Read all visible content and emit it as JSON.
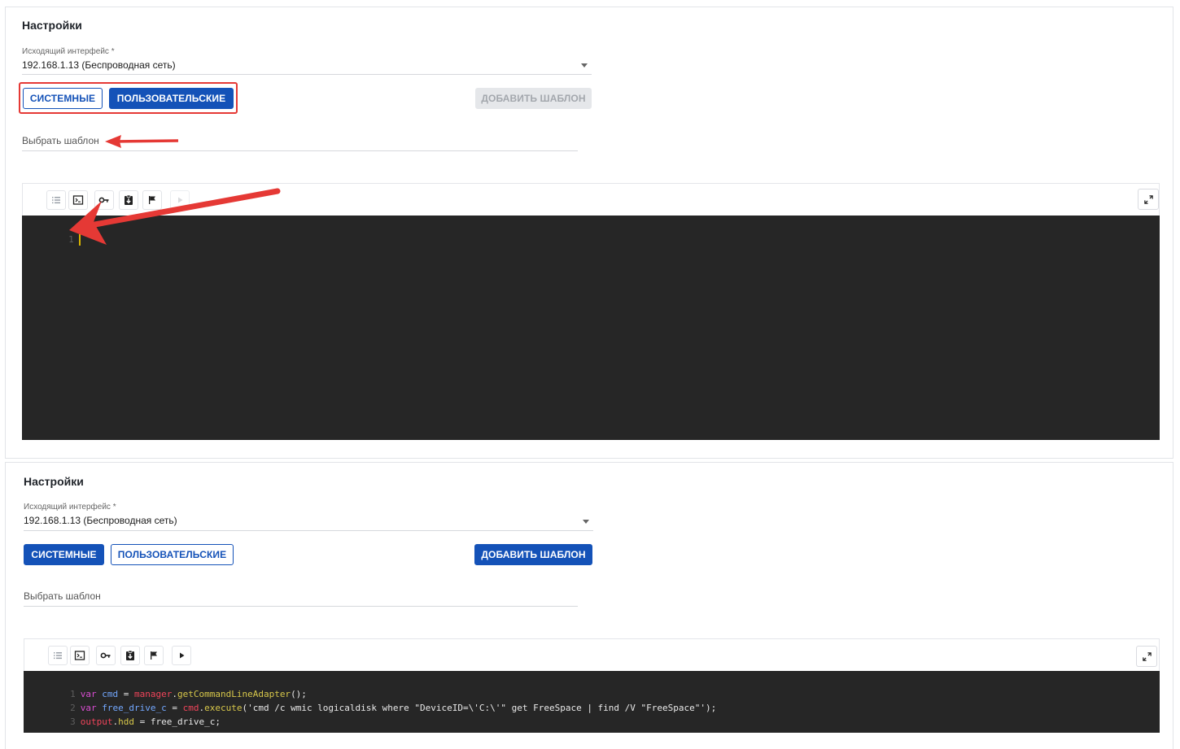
{
  "settings": {
    "title": "Настройки",
    "iface_label": "Исходящий интерфейс *",
    "iface_value": "192.168.1.13 (Беспроводная сеть)",
    "system_label": "СИСТЕМНЫЕ",
    "custom_label": "ПОЛЬЗОВАТЕЛЬСКИЕ",
    "add_template_label": "ДОБАВИТЬ ШАБЛОН",
    "choose_template": "Выбрать шаблон"
  },
  "panel1": {
    "active_tab": "custom",
    "add_template_enabled": false,
    "code_lines": [
      {
        "num": "1"
      }
    ]
  },
  "panel2": {
    "active_tab": "system",
    "add_template_enabled": true,
    "code_lines": [
      {
        "num": "1",
        "kw": "var",
        "v": "cmd",
        "eq": " = ",
        "obj": "manager",
        "dot": ".",
        "fn": "getCommandLineAdapter",
        "rest": "();"
      },
      {
        "num": "2",
        "kw": "var",
        "v": "free_drive_c",
        "eq": " = ",
        "obj": "cmd",
        "dot": ".",
        "fn": "execute",
        "rest": "('cmd /c wmic logicaldisk where \"DeviceID=\\'C:\\'\" get FreeSpace | find /V \"FreeSpace\"');"
      },
      {
        "num": "3",
        "obj": "output",
        "dot": ".",
        "fn": "hdd",
        "rest": " = free_drive_c;"
      }
    ]
  },
  "colors": {
    "primary": "#1452b8",
    "annotation": "#e53935",
    "editor_bg": "#262626"
  },
  "icons": [
    "list-icon",
    "terminal-icon",
    "key-icon",
    "clipboard-download-icon",
    "flag-icon",
    "play-icon",
    "expand-icon"
  ]
}
